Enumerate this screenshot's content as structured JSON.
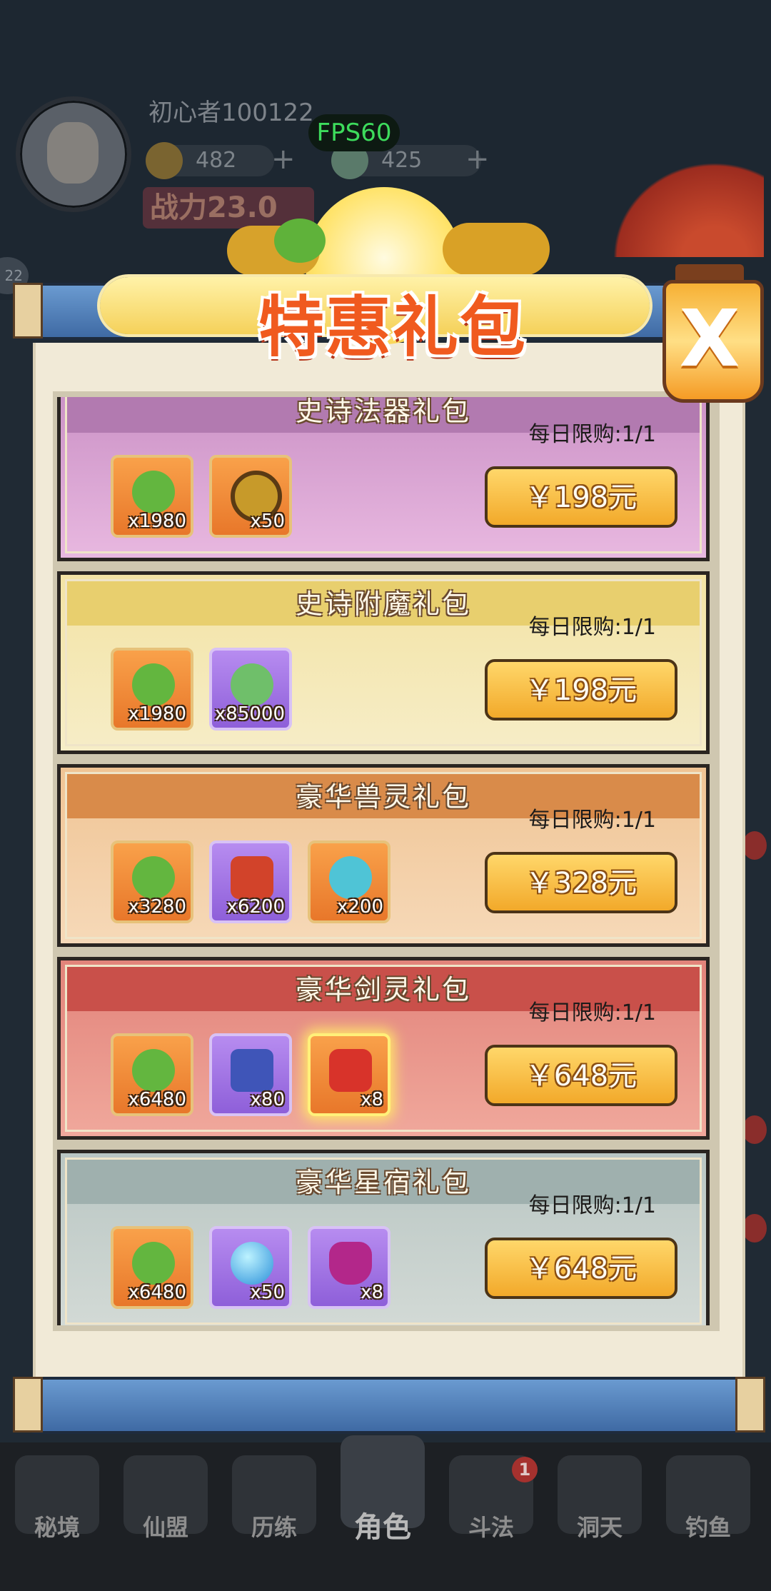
{
  "hud": {
    "player_name": "初心者100122",
    "coins": "482",
    "gems": "425",
    "fps": "FPS60",
    "power_label": "战力23.0",
    "side_badge": "22",
    "plus": "+"
  },
  "popup": {
    "title": "特惠礼包",
    "close_label": "X"
  },
  "packs": [
    {
      "title": "史诗法器礼包",
      "limit": "每日限购:1/1",
      "price": "￥198元",
      "items": [
        {
          "icon": "jade-icon",
          "qty": "x1980"
        },
        {
          "icon": "taiji-compass-icon",
          "qty": "x50"
        }
      ]
    },
    {
      "title": "史诗附魔礼包",
      "limit": "每日限购:1/1",
      "price": "￥198元",
      "items": [
        {
          "icon": "jade-icon",
          "qty": "x1980"
        },
        {
          "icon": "enchant-stone-icon",
          "qty": "x85000"
        }
      ]
    },
    {
      "title": "豪华兽灵礼包",
      "limit": "每日限购:1/1",
      "price": "￥328元",
      "items": [
        {
          "icon": "jade-icon",
          "qty": "x3280"
        },
        {
          "icon": "fire-crystal-icon",
          "qty": "x6200"
        },
        {
          "icon": "spirit-orb-icon",
          "qty": "x200"
        }
      ]
    },
    {
      "title": "豪华剑灵礼包",
      "limit": "每日限购:1/1",
      "price": "￥648元",
      "items": [
        {
          "icon": "jade-icon",
          "qty": "x6480"
        },
        {
          "icon": "rune-stone-icon",
          "qty": "x80"
        },
        {
          "icon": "sword-spirit-icon",
          "qty": "x8"
        }
      ]
    },
    {
      "title": "豪华星宿礼包",
      "limit": "每日限购:1/1",
      "price": "￥648元",
      "items": [
        {
          "icon": "jade-icon",
          "qty": "x6480"
        },
        {
          "icon": "crystal-ball-icon",
          "qty": "x50"
        },
        {
          "icon": "lucky-bag-icon",
          "qty": "x8"
        }
      ]
    }
  ],
  "nav": {
    "items": [
      {
        "label": "秘境"
      },
      {
        "label": "仙盟"
      },
      {
        "label": "历练"
      },
      {
        "label": "角色"
      },
      {
        "label": "斗法"
      },
      {
        "label": "洞天"
      },
      {
        "label": "钓鱼"
      }
    ],
    "badge": "1"
  },
  "colors": {
    "title": "#f05a1f",
    "buy_button": "#f2a92a",
    "fps": "#3ddc5c"
  }
}
